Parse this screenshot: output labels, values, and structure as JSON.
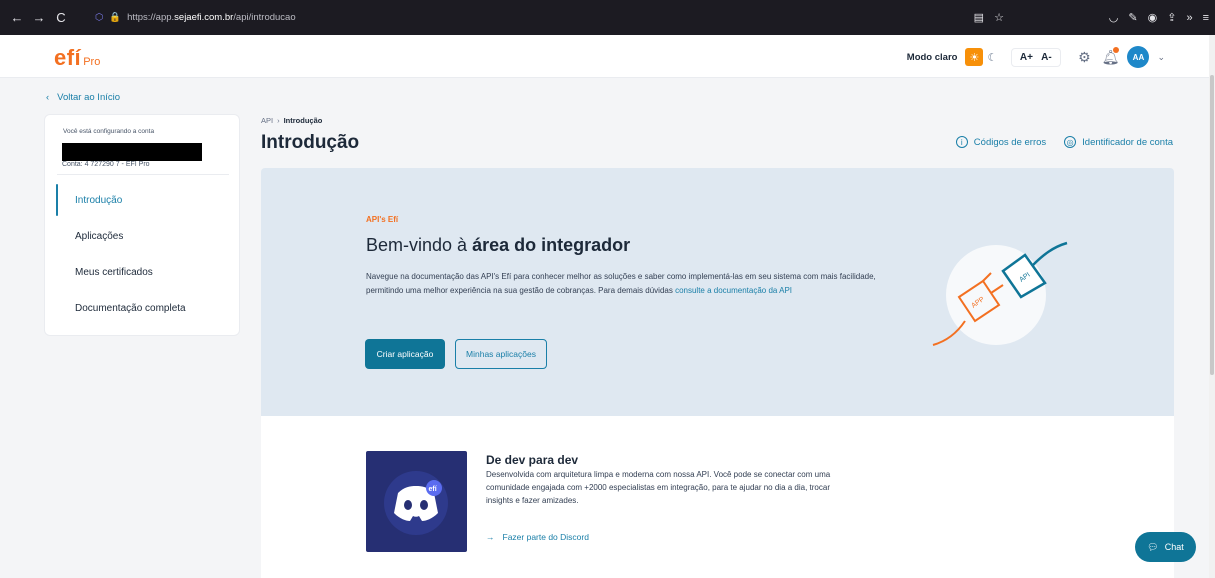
{
  "browser": {
    "back": "←",
    "forward": "→",
    "reload": "C",
    "url_scheme": "https://app.",
    "url_host": "sejaefi.com.br",
    "url_path": "/api/introducao"
  },
  "header": {
    "logo_main": "efí",
    "logo_sub": "Pro",
    "mode_label": "Modo claro",
    "font_increase": "A+",
    "font_decrease": "A-",
    "avatar_initials": "AA"
  },
  "nav": {
    "back_label": "Voltar ao Início"
  },
  "sidebar": {
    "account_label": "Você está configurando a conta",
    "account_number": "Conta: 4 727290 7 - EFI Pro",
    "items": [
      {
        "label": "Introdução",
        "active": true
      },
      {
        "label": "Aplicações"
      },
      {
        "label": "Meus certificados"
      },
      {
        "label": "Documentação completa"
      }
    ]
  },
  "breadcrumb": {
    "root": "API",
    "separator": "›",
    "current": "Introdução"
  },
  "page_title": "Introdução",
  "top_links": {
    "error_codes": "Códigos de erros",
    "account_id": "Identificador de conta"
  },
  "hero": {
    "eyebrow": "API's Efí",
    "title_prefix": "Bem-vindo à ",
    "title_bold": "área do integrador",
    "description": "Navegue na documentação das API's Efí para conhecer melhor as soluções e saber como implementá-las em seu sistema com mais facilidade, permitindo uma melhor experiência na sua gestão de cobranças. Para demais dúvidas ",
    "description_link": "consulte a documentação da API",
    "primary_button": "Criar aplicação",
    "secondary_button": "Minhas aplicações",
    "plug_left_label": "APP",
    "plug_right_label": "API"
  },
  "discord": {
    "title": "De dev para dev",
    "description": "Desenvolvida com arquitetura limpa e moderna com nossa API. Você pode se conectar com uma comunidade engajada com +2000 especialistas em integração, para te ajudar no dia a dia, trocar insights e fazer amizades.",
    "link": "Fazer parte do Discord",
    "badge": "efí"
  },
  "chat": {
    "label": "Chat"
  },
  "colors": {
    "brand_orange": "#f37021",
    "accent_teal": "#0f7597",
    "hero_bg": "#dfe8f1"
  }
}
